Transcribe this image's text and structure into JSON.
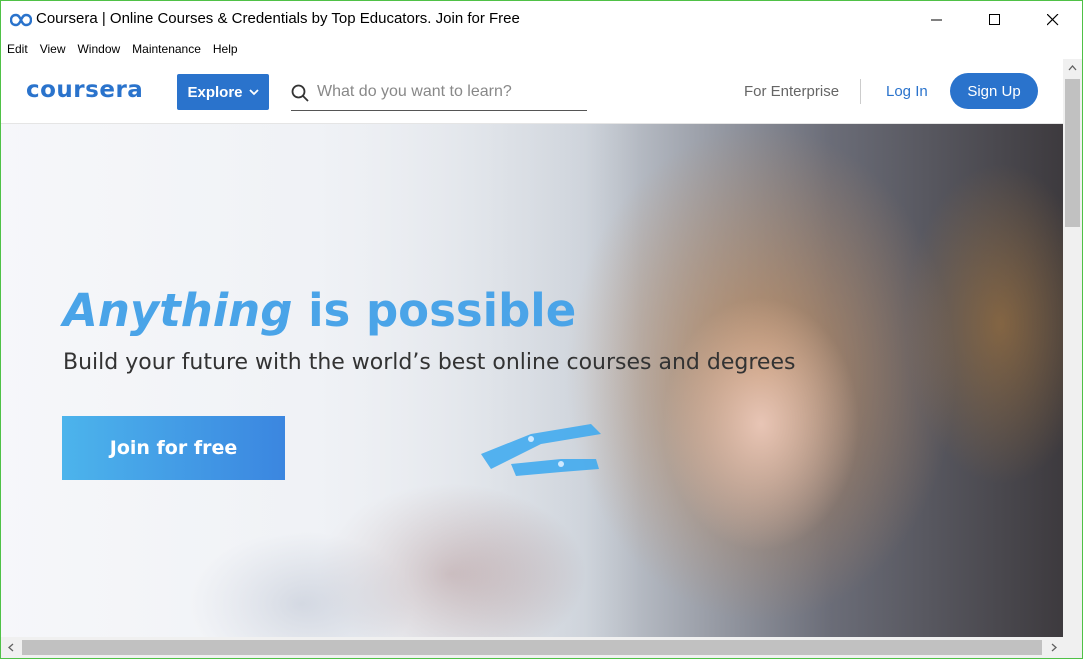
{
  "window": {
    "title": "Coursera | Online Courses & Credentials by Top Educators. Join for Free"
  },
  "menu": [
    "Edit",
    "View",
    "Window",
    "Maintenance",
    "Help"
  ],
  "header": {
    "logo": "coursera",
    "explore_label": "Explore",
    "search_placeholder": "What do you want to learn?",
    "enterprise_label": "For Enterprise",
    "login_label": "Log In",
    "signup_label": "Sign Up"
  },
  "hero": {
    "title_emphasis": "Anything",
    "title_rest": "is possible",
    "subtitle": "Build your future with the world’s best online courses and degrees",
    "cta_label": "Join for free"
  },
  "colors": {
    "brand": "#2a73cc",
    "hero_title": "#4aa4e8",
    "window_border": "#4fc146"
  },
  "icons": {
    "app": "coursera-infinity-icon",
    "search": "search-icon",
    "explore_chevron": "chevron-down-icon"
  }
}
